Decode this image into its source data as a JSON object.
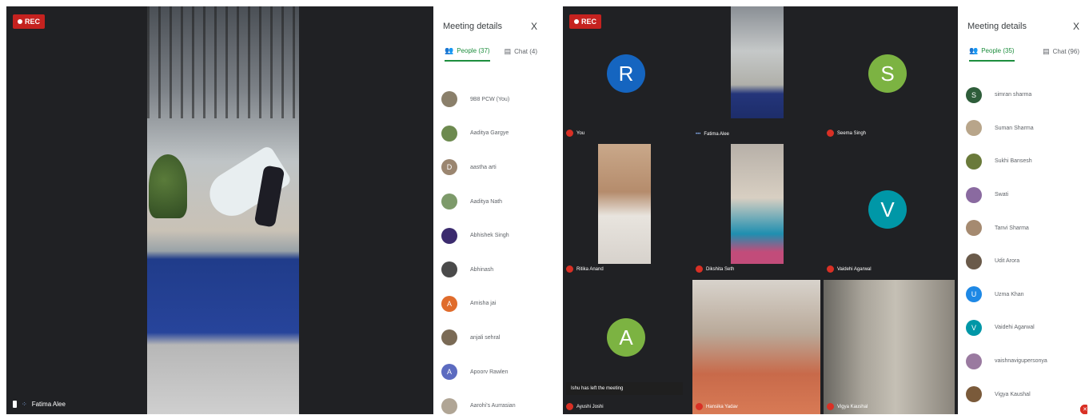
{
  "left": {
    "rec_label": "REC",
    "speaker_name": "Fatima Alee",
    "panel": {
      "title": "Meeting details",
      "close": "X",
      "tab_people": "People (37)",
      "tab_chat": "Chat (4)",
      "people": [
        {
          "name": "9B8 PCW (You)",
          "color": "#8a7f6a",
          "initial": ""
        },
        {
          "name": "Aaditya Gargye",
          "color": "#6d8a4f",
          "initial": ""
        },
        {
          "name": "aastha arti",
          "color": "#9b8670",
          "initial": "D"
        },
        {
          "name": "Aaditya Nath",
          "color": "#7d9a6a",
          "initial": ""
        },
        {
          "name": "Abhishek Singh",
          "color": "#3b2b6e",
          "initial": ""
        },
        {
          "name": "Abhinash",
          "color": "#4a4a4a",
          "initial": ""
        },
        {
          "name": "Amisha jai",
          "color": "#e06c2c",
          "initial": "A"
        },
        {
          "name": "anjali sehral",
          "color": "#7a6a55",
          "initial": ""
        },
        {
          "name": "Apoorv Rawlen",
          "color": "#5c6bc0",
          "initial": "A"
        },
        {
          "name": "Aarohi's Aurrasian",
          "color": "#b0a595",
          "initial": ""
        }
      ]
    }
  },
  "right": {
    "rec_label": "REC",
    "tiles": [
      {
        "name": "You",
        "initial": "R",
        "color": "#1565c0"
      },
      {
        "name": "Fatima Alee",
        "initial": "",
        "color": ""
      },
      {
        "name": "Seema Singh",
        "initial": "S",
        "color": "#7cb342"
      },
      {
        "name": "Ritika Anand",
        "initial": "",
        "color": ""
      },
      {
        "name": "Dikshita Seth",
        "initial": "",
        "color": ""
      },
      {
        "name": "Vaidehi Agarwal",
        "initial": "V",
        "color": "#0097a7"
      },
      {
        "name": "Ayushi Joshi",
        "initial": "A",
        "color": "#7cb342"
      },
      {
        "name": "Hansika Yadav",
        "initial": "",
        "color": ""
      },
      {
        "name": "Vigya Kaushal",
        "initial": "",
        "color": ""
      }
    ],
    "toast": "Ishu has left the meeting",
    "panel": {
      "title": "Meeting details",
      "close": "X",
      "tab_people": "People (35)",
      "tab_chat": "Chat (96)",
      "people": [
        {
          "name": "simran sharma",
          "color": "#2e5d3a",
          "initial": "S"
        },
        {
          "name": "Suman Sharma",
          "color": "#b8a58a",
          "initial": ""
        },
        {
          "name": "Sukhi Bansesh",
          "color": "#6a7a3a",
          "initial": ""
        },
        {
          "name": "Swati",
          "color": "#8a6aa0",
          "initial": ""
        },
        {
          "name": "Tanvi Sharma",
          "color": "#a58a70",
          "initial": ""
        },
        {
          "name": "Udit Arora",
          "color": "#6a5a4a",
          "initial": ""
        },
        {
          "name": "Uzma Khan",
          "color": "#1e88e5",
          "initial": "U"
        },
        {
          "name": "Vaidehi Agarwal",
          "color": "#0097a7",
          "initial": "V"
        },
        {
          "name": "vaishnavigupersonya",
          "color": "#9a7aa0",
          "initial": ""
        },
        {
          "name": "Vigya Kaushal",
          "color": "#7a5a3a",
          "initial": ""
        }
      ]
    }
  }
}
